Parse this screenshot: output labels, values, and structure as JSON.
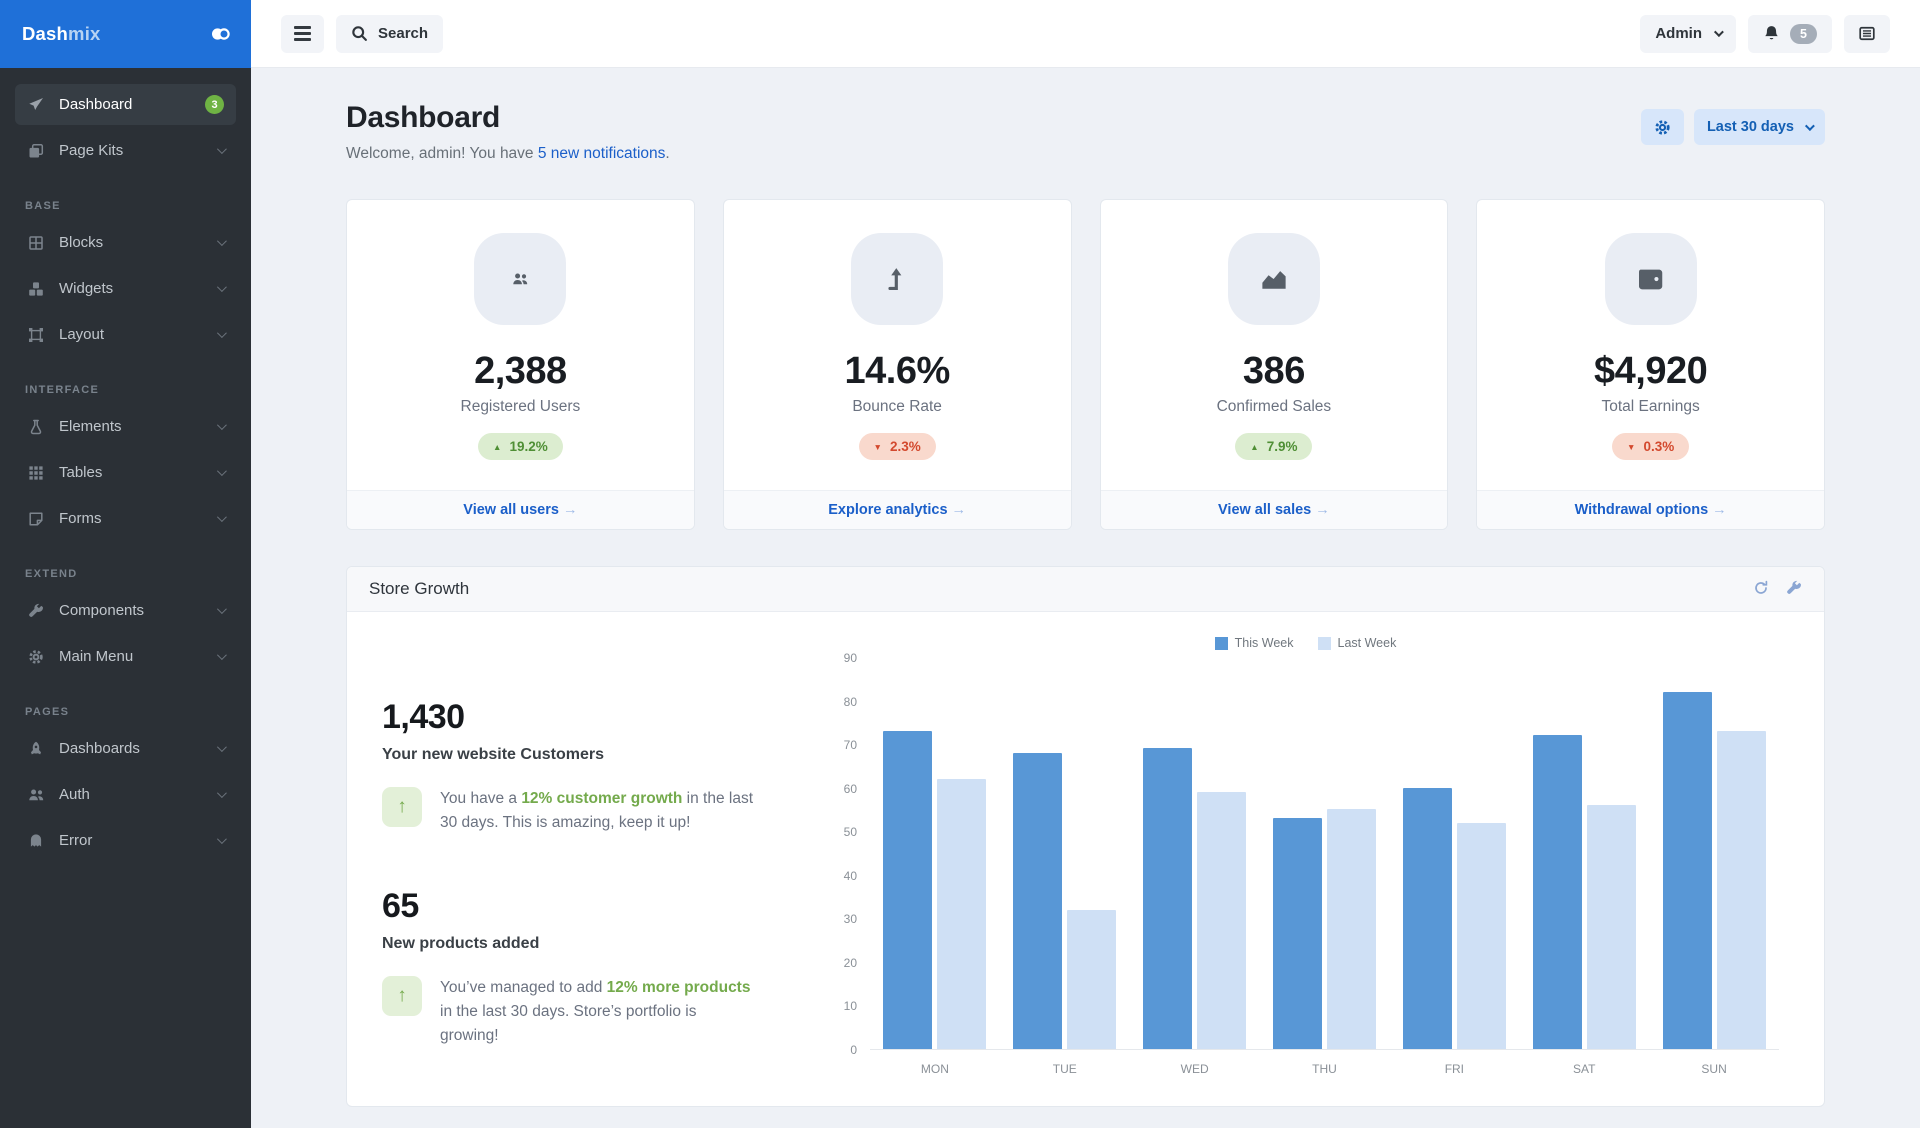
{
  "brand": {
    "bold": "Dash",
    "light": "mix"
  },
  "sidebar": {
    "sections": [
      {
        "heading": null,
        "items": [
          {
            "label": "Dashboard",
            "icon": "send",
            "badge": "3",
            "active": true
          },
          {
            "label": "Page Kits",
            "icon": "layers",
            "chevron": true
          }
        ]
      },
      {
        "heading": "BASE",
        "items": [
          {
            "label": "Blocks",
            "icon": "grid",
            "chevron": true
          },
          {
            "label": "Widgets",
            "icon": "widgets",
            "chevron": true
          },
          {
            "label": "Layout",
            "icon": "layout",
            "chevron": true
          }
        ]
      },
      {
        "heading": "INTERFACE",
        "items": [
          {
            "label": "Elements",
            "icon": "flask",
            "chevron": true
          },
          {
            "label": "Tables",
            "icon": "cells",
            "chevron": true
          },
          {
            "label": "Forms",
            "icon": "note",
            "chevron": true
          }
        ]
      },
      {
        "heading": "EXTEND",
        "items": [
          {
            "label": "Components",
            "icon": "wrench",
            "chevron": true
          },
          {
            "label": "Main Menu",
            "icon": "gear",
            "chevron": true
          }
        ]
      },
      {
        "heading": "PAGES",
        "items": [
          {
            "label": "Dashboards",
            "icon": "rocket",
            "chevron": true
          },
          {
            "label": "Auth",
            "icon": "users",
            "chevron": true
          },
          {
            "label": "Error",
            "icon": "ghost",
            "chevron": true
          }
        ]
      }
    ]
  },
  "topbar": {
    "search_label": "Search",
    "user_label": "Admin",
    "notification_count": "5"
  },
  "hero": {
    "title": "Dashboard",
    "welcome_prefix": "Welcome, admin! You have ",
    "welcome_link": "5 new notifications",
    "welcome_suffix": ".",
    "range_label": "Last 30 days"
  },
  "cards": [
    {
      "icon": "users",
      "value": "2,388",
      "label": "Registered Users",
      "delta": "19.2%",
      "direction": "up",
      "link": "View all users"
    },
    {
      "icon": "arrow-turn-up",
      "value": "14.6%",
      "label": "Bounce Rate",
      "delta": "2.3%",
      "direction": "down",
      "link": "Explore analytics"
    },
    {
      "icon": "chart-line",
      "value": "386",
      "label": "Confirmed Sales",
      "delta": "7.9%",
      "direction": "up",
      "link": "View all sales"
    },
    {
      "icon": "wallet",
      "value": "$4,920",
      "label": "Total Earnings",
      "delta": "0.3%",
      "direction": "down",
      "link": "Withdrawal options"
    }
  ],
  "store_growth": {
    "title": "Store Growth",
    "stats": [
      {
        "value": "1,430",
        "label": "Your new website Customers",
        "text_prefix": "You have a ",
        "text_highlight": "12% customer growth",
        "text_suffix": " in the last 30 days. This is amazing, keep it up!"
      },
      {
        "value": "65",
        "label": "New products added",
        "text_prefix": "You’ve managed to add ",
        "text_highlight": "12% more products",
        "text_suffix": " in the last 30 days. Store’s portfolio is growing!"
      }
    ]
  },
  "chart_data": {
    "type": "bar",
    "title": "Store Growth",
    "categories": [
      "MON",
      "TUE",
      "WED",
      "THU",
      "FRI",
      "SAT",
      "SUN"
    ],
    "series": [
      {
        "name": "This Week",
        "color": "#5897d6",
        "values": [
          73,
          68,
          69,
          53,
          60,
          72,
          82
        ]
      },
      {
        "name": "Last Week",
        "color": "#cfe0f5",
        "values": [
          62,
          32,
          59,
          55,
          52,
          56,
          73
        ]
      }
    ],
    "xlabel": "",
    "ylabel": "",
    "ylim": [
      0,
      90
    ],
    "ytick_step": 10,
    "grid": false,
    "legend_position": "top"
  },
  "colors": {
    "primary": "#1f70d8",
    "sidebar_bg": "#2b3036",
    "link": "#1b5fc9",
    "positive_text": "#4f8f35",
    "positive_bg": "#dcedd0",
    "negative_text": "#d3492e",
    "negative_bg": "#f9d9cd",
    "badge_green": "#6fb344",
    "page_bg": "#eef1f6"
  }
}
